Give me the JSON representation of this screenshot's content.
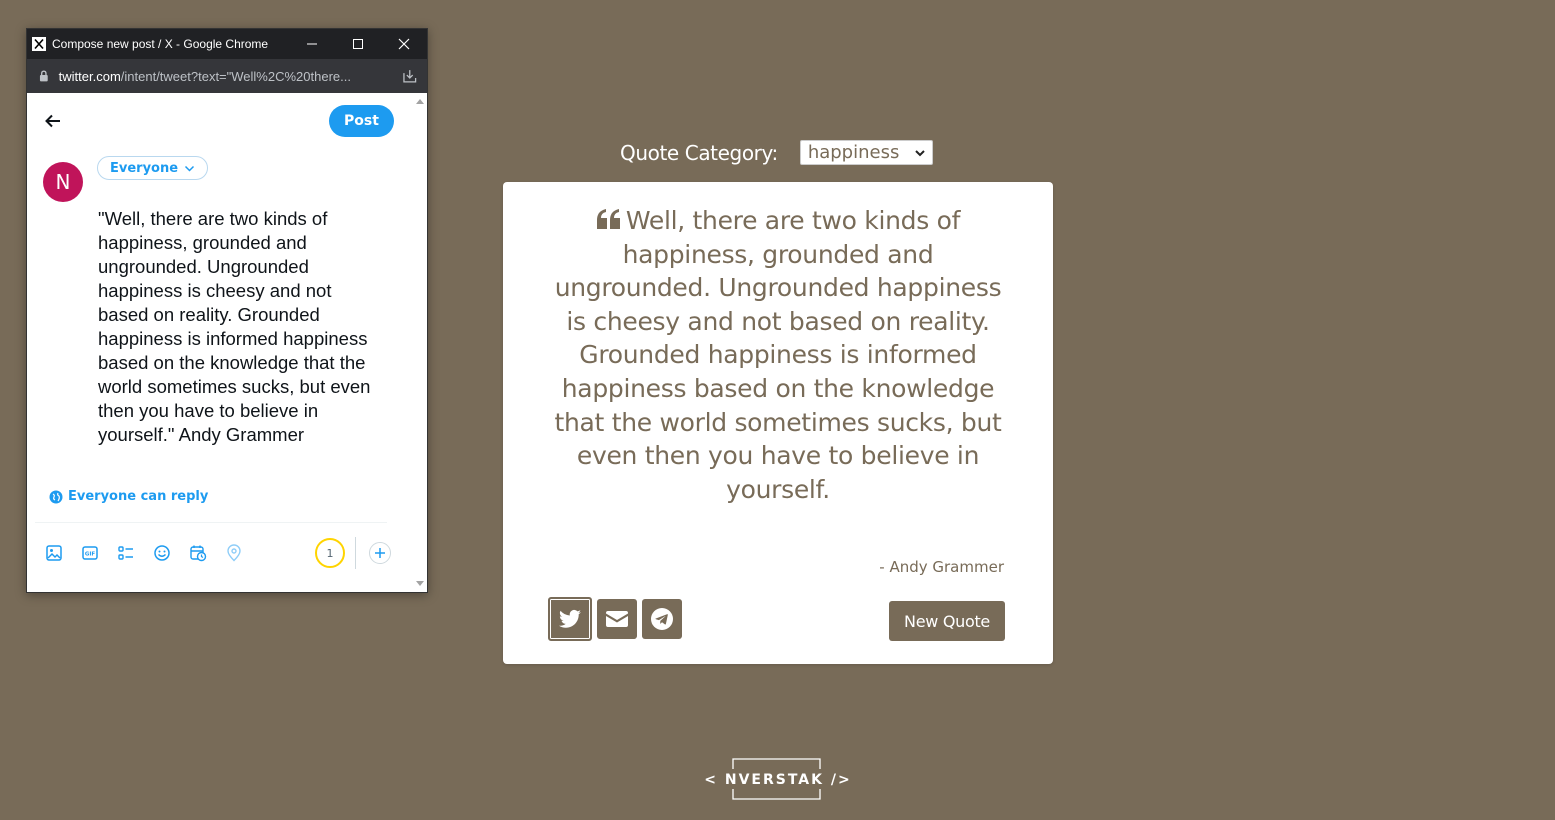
{
  "app": {
    "category_label": "Quote Category:",
    "category_selected": "happiness",
    "quote_text": "Well, there are two kinds of happiness, grounded and ungrounded. Ungrounded happiness is cheesy and not based on reality. Grounded happiness is informed happiness based on the knowledge that the world sometimes sucks, but even then you have to believe in yourself.",
    "quote_author": "- Andy Grammer",
    "new_quote_label": "New Quote",
    "share_icons": [
      "twitter-icon",
      "envelope-icon",
      "telegram-icon"
    ],
    "brand_text": "< NVERSTAK />",
    "colors": {
      "background": "#786b58",
      "card": "#ffffff",
      "text": "#786b58"
    }
  },
  "popup": {
    "window_title": "Compose new post / X - Google Chrome",
    "url_host": "twitter.com",
    "url_path": "/intent/tweet?text=\"Well%2C%20there...",
    "post_label": "Post",
    "avatar_initial": "N",
    "audience_label": "Everyone",
    "tweet_text": "\"Well, there are two kinds of happiness, grounded and ungrounded. Ungrounded happiness is cheesy and not based on reality. Grounded happiness is informed happiness based on the knowledge that the world sometimes sucks, but even then you have to believe in yourself.\" Andy Grammer",
    "reply_setting": "Everyone can reply",
    "char_counter": "1",
    "toolbar_icons": [
      "image-icon",
      "gif-icon",
      "poll-icon",
      "emoji-icon",
      "schedule-icon",
      "location-icon"
    ],
    "colors": {
      "accent": "#1d9bf0",
      "avatar": "#c0145a",
      "counter_ring": "#ffd400"
    }
  }
}
